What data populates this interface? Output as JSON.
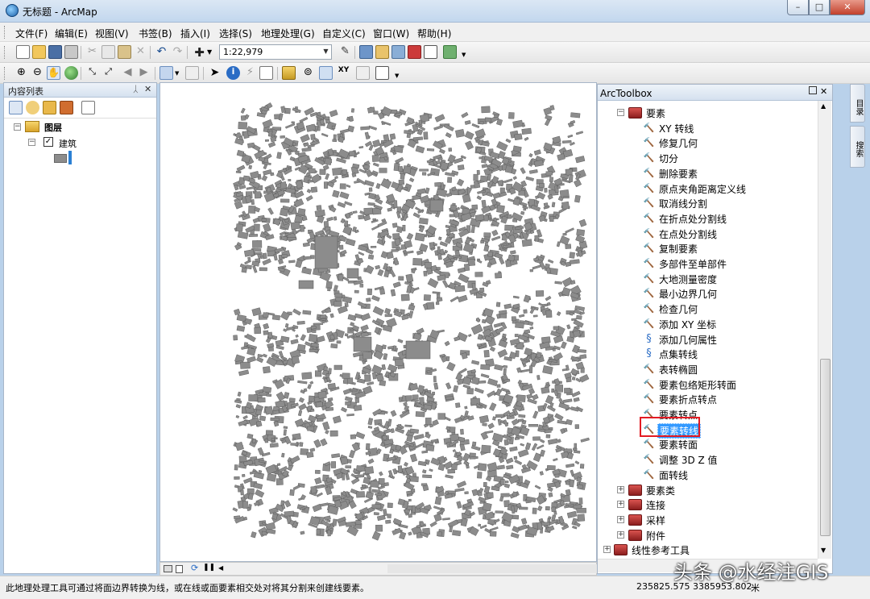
{
  "window": {
    "title": "无标题 - ArcMap",
    "controls": {
      "minimize": "–",
      "maximize": "□",
      "close": "✕"
    }
  },
  "menu": [
    "文件(F)",
    "编辑(E)",
    "视图(V)",
    "书签(B)",
    "插入(I)",
    "选择(S)",
    "地理处理(G)",
    "自定义(C)",
    "窗口(W)",
    "帮助(H)"
  ],
  "toolbar": {
    "scale": "1:22,979"
  },
  "toc": {
    "title": "内容列表",
    "pin": "ᛸ",
    "close": "✕",
    "layers_group": "图层",
    "layer": "建筑",
    "checked": "✓",
    "expanded_sign": "−"
  },
  "toolbox": {
    "title": "ArcToolbox",
    "toolset": "要素",
    "tools": [
      {
        "label": "XY 转线",
        "icon": "hammer-icon"
      },
      {
        "label": "修复几何",
        "icon": "hammer-icon"
      },
      {
        "label": "切分",
        "icon": "hammer-icon"
      },
      {
        "label": "删除要素",
        "icon": "hammer-icon"
      },
      {
        "label": "原点夹角距离定义线",
        "icon": "hammer-icon"
      },
      {
        "label": "取消线分割",
        "icon": "hammer-icon"
      },
      {
        "label": "在折点处分割线",
        "icon": "hammer-icon"
      },
      {
        "label": "在点处分割线",
        "icon": "hammer-icon"
      },
      {
        "label": "复制要素",
        "icon": "hammer-icon"
      },
      {
        "label": "多部件至单部件",
        "icon": "hammer-icon"
      },
      {
        "label": "大地测量密度",
        "icon": "hammer-icon"
      },
      {
        "label": "最小边界几何",
        "icon": "hammer-icon"
      },
      {
        "label": "检查几何",
        "icon": "hammer-icon"
      },
      {
        "label": "添加 XY 坐标",
        "icon": "hammer-icon"
      },
      {
        "label": "添加几何属性",
        "icon": "script-icon"
      },
      {
        "label": "点集转线",
        "icon": "script-icon"
      },
      {
        "label": "表转椭圆",
        "icon": "hammer-icon"
      },
      {
        "label": "要素包络矩形转面",
        "icon": "hammer-icon"
      },
      {
        "label": "要素折点转点",
        "icon": "hammer-icon"
      },
      {
        "label": "要素转点",
        "icon": "hammer-icon"
      },
      {
        "label": "要素转线",
        "icon": "hammer-icon",
        "selected": true
      },
      {
        "label": "要素转面",
        "icon": "hammer-icon"
      },
      {
        "label": "调整 3D Z 值",
        "icon": "hammer-icon"
      },
      {
        "label": "面转线",
        "icon": "hammer-icon"
      }
    ],
    "collapsed_toolsets": [
      "要素类",
      "连接",
      "采样",
      "附件"
    ],
    "bottom_toolbox": "线性参考工具",
    "expand_sign": "+",
    "collapse_sign": "−"
  },
  "side_tabs": [
    "目录",
    "搜索"
  ],
  "status": {
    "message": "此地理处理工具可通过将面边界转换为线，或在线或面要素相交处对将其分割来创建线要素。",
    "coords": "235825.575  3385953.802",
    "units": "米"
  },
  "watermark": "头条 @水经注GIS",
  "colors": {
    "selection": "#3399ff",
    "highlight_box": "#e31b23",
    "buildings": "#8c8c8c"
  }
}
